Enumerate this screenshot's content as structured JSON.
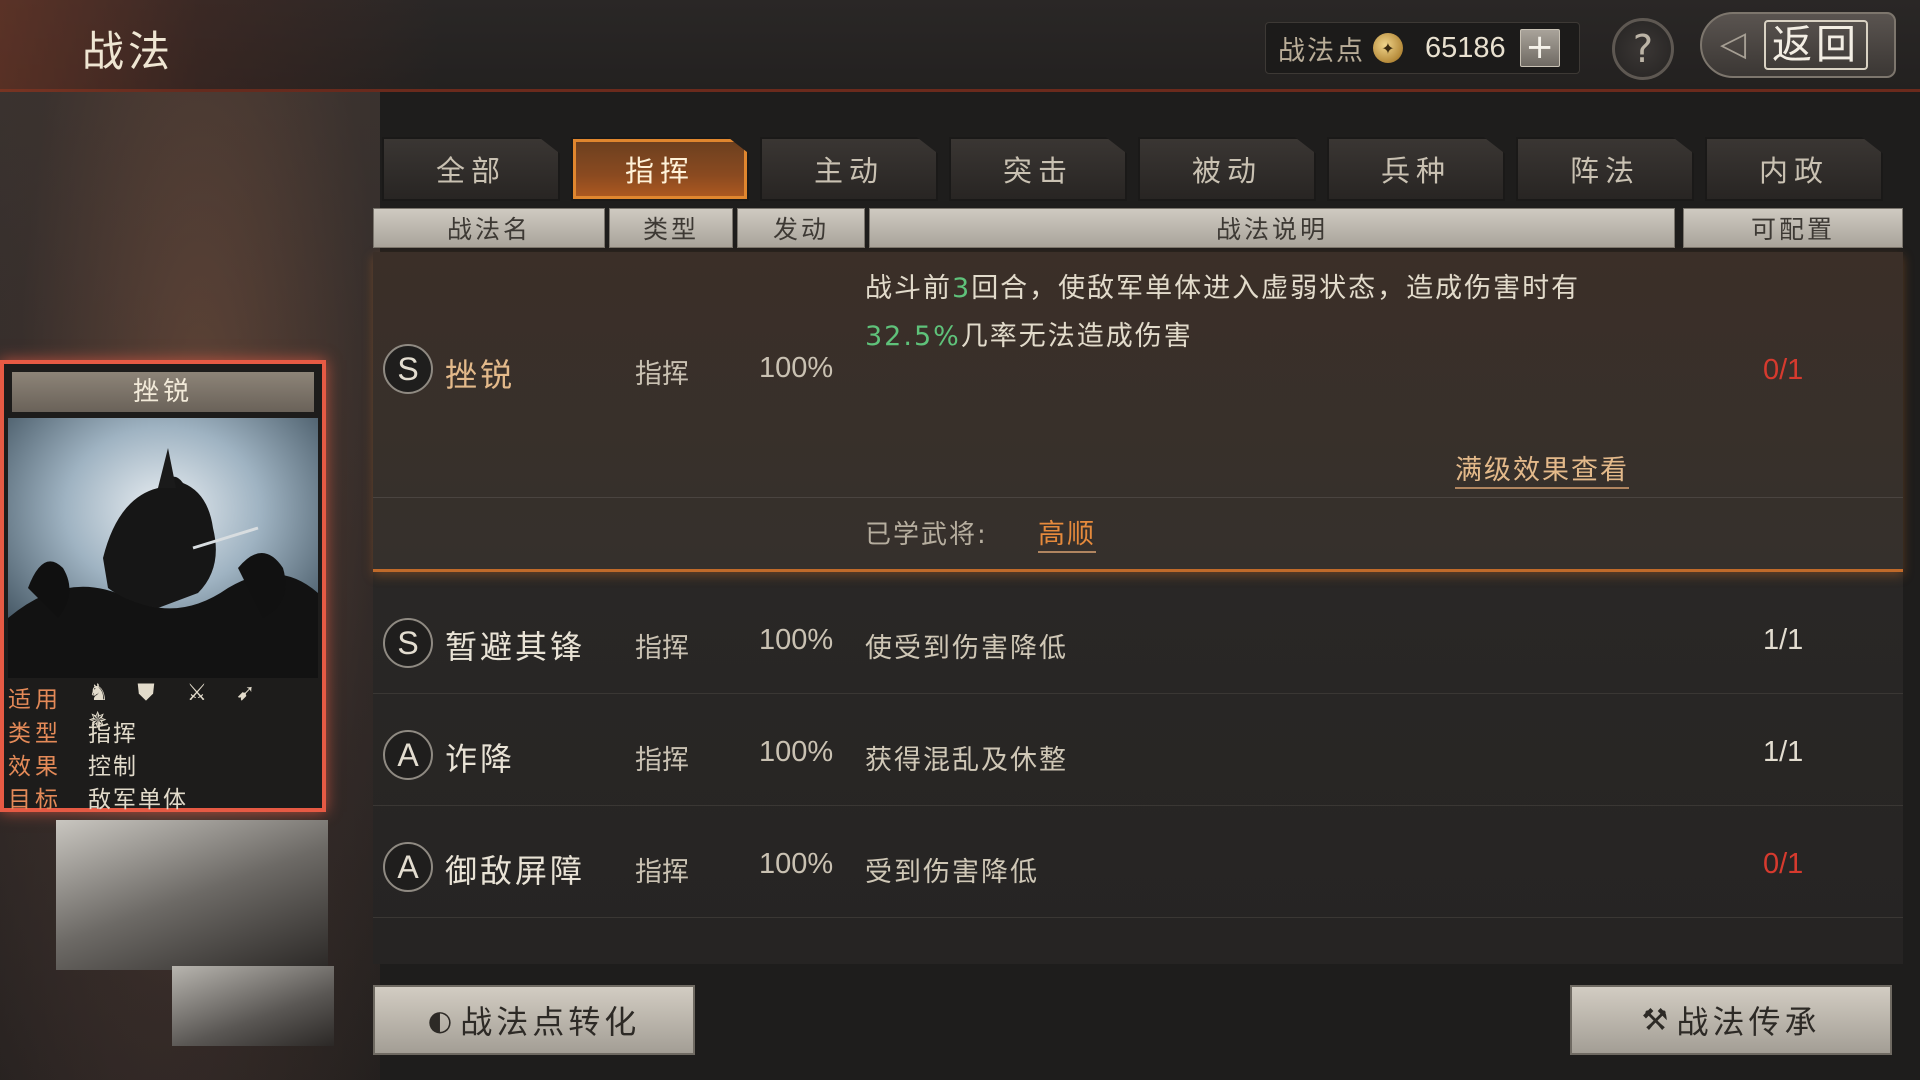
{
  "header": {
    "title": "战法",
    "points_label": "战法点",
    "points_value": "65186",
    "add_label": "+",
    "help_label": "?",
    "back_label": "返回"
  },
  "tabs": [
    {
      "label": "全部",
      "active": false
    },
    {
      "label": "指挥",
      "active": true
    },
    {
      "label": "主动",
      "active": false
    },
    {
      "label": "突击",
      "active": false
    },
    {
      "label": "被动",
      "active": false
    },
    {
      "label": "兵种",
      "active": false
    },
    {
      "label": "阵法",
      "active": false
    },
    {
      "label": "内政",
      "active": false
    }
  ],
  "columns": {
    "name": "战法名",
    "type": "类型",
    "rate": "发动",
    "desc": "战法说明",
    "count": "可配置"
  },
  "selected_skill": {
    "grade": "S",
    "name": "挫锐",
    "type": "指挥",
    "rate": "100%",
    "desc_line1_pre": "战斗前",
    "desc_line1_num": "3",
    "desc_line1_post": "回合，使敌军单体进入虚弱状态，造成伤害时有",
    "desc_line2_num": "32.5%",
    "desc_line2_post": "几率无法造成伤害",
    "count": "0/1",
    "full_effect_link": "满级效果查看",
    "learned_label": "已学武将:",
    "learned_general": "高顺"
  },
  "skills": [
    {
      "grade": "S",
      "name": "暂避其锋",
      "type": "指挥",
      "rate": "100%",
      "desc": "使受到伤害降低",
      "count": "1/1"
    },
    {
      "grade": "A",
      "name": "诈降",
      "type": "指挥",
      "rate": "100%",
      "desc": "获得混乱及休整",
      "count": "1/1"
    },
    {
      "grade": "A",
      "name": "御敌屏障",
      "type": "指挥",
      "rate": "100%",
      "desc": "受到伤害降低",
      "count": "0/1"
    }
  ],
  "buttons": {
    "convert": "战法点转化",
    "inherit": "战法传承"
  },
  "card": {
    "title": "挫锐",
    "use_label": "适用",
    "use_icons": [
      "cavalry-icon",
      "shield-icon",
      "crossed-weapons-icon",
      "bow-icon",
      "wheel-icon"
    ],
    "type_label": "类型",
    "type_value": "指挥",
    "effect_label": "效果",
    "effect_value": "控制",
    "target_label": "目标",
    "target_value": "敌军单体"
  },
  "colors": {
    "accent_orange": "#e0862e",
    "highlight_green": "#5fc27a",
    "warning_red": "#d63a2e"
  }
}
